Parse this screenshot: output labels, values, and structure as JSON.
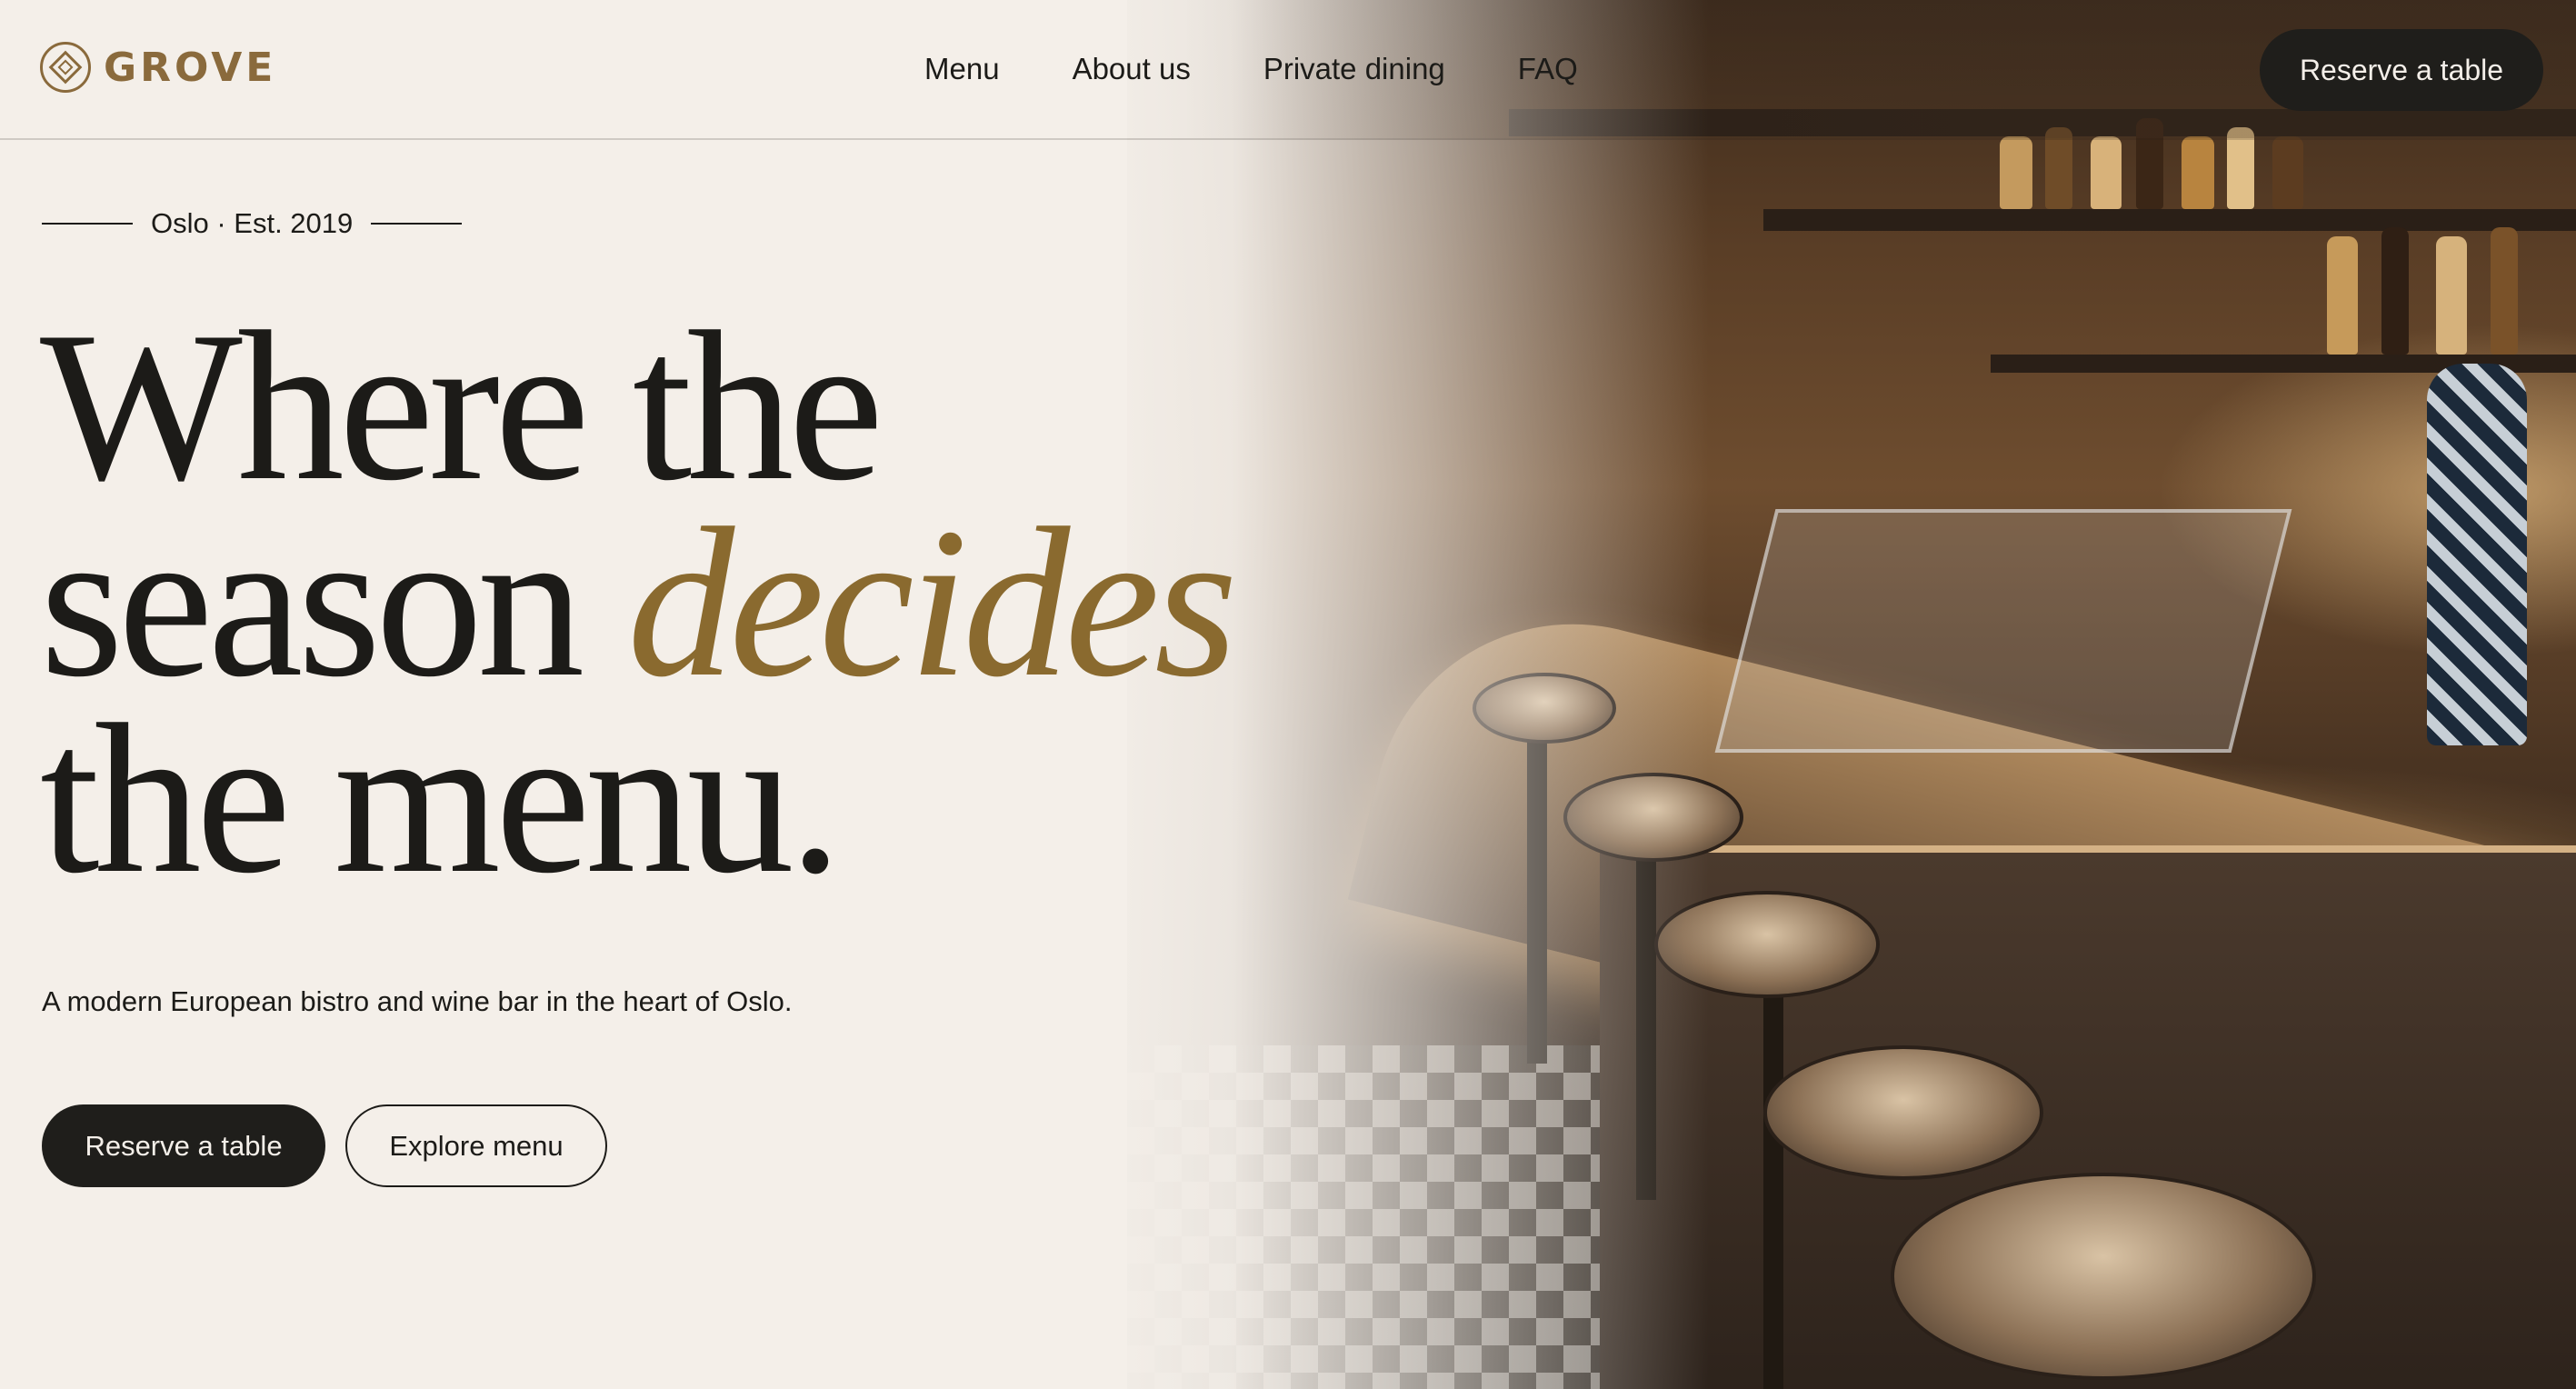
{
  "brand": {
    "name": "GROVE",
    "logo_icon": "diamond-in-circle-icon",
    "accent_color": "#8a6a3c"
  },
  "nav": {
    "items": [
      {
        "label": "Menu"
      },
      {
        "label": "About us"
      },
      {
        "label": "Private dining"
      },
      {
        "label": "FAQ"
      }
    ],
    "cta_label": "Reserve a table"
  },
  "hero": {
    "eyebrow": "Oslo · Est. 2019",
    "headline": {
      "line1": "Where the",
      "line2_start": "season",
      "line2_accent": "decides",
      "line3": "the menu."
    },
    "subtitle": "A modern European bistro and wine bar in the heart of Oslo.",
    "primary_button": "Reserve a table",
    "secondary_button": "Explore menu"
  },
  "colors": {
    "background": "#f4efe9",
    "text": "#1c1b18",
    "headline_accent": "#8a6a2f",
    "button_dark": "#1f1e1b"
  }
}
